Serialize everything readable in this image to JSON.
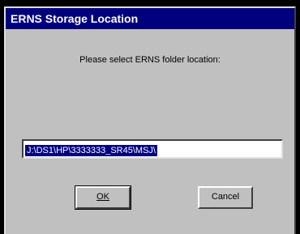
{
  "dialog": {
    "title": "ERNS Storage Location",
    "prompt": "Please select ERNS folder location:",
    "path_value": "J:\\DS1\\HP\\3333333_SR45\\MSJ\\",
    "ok_label": "OK",
    "cancel_label": "Cancel"
  },
  "colors": {
    "titlebar": "#00007f",
    "dialog_bg": "#c0c0c0",
    "selection": "#00007f",
    "background": "#000000"
  }
}
